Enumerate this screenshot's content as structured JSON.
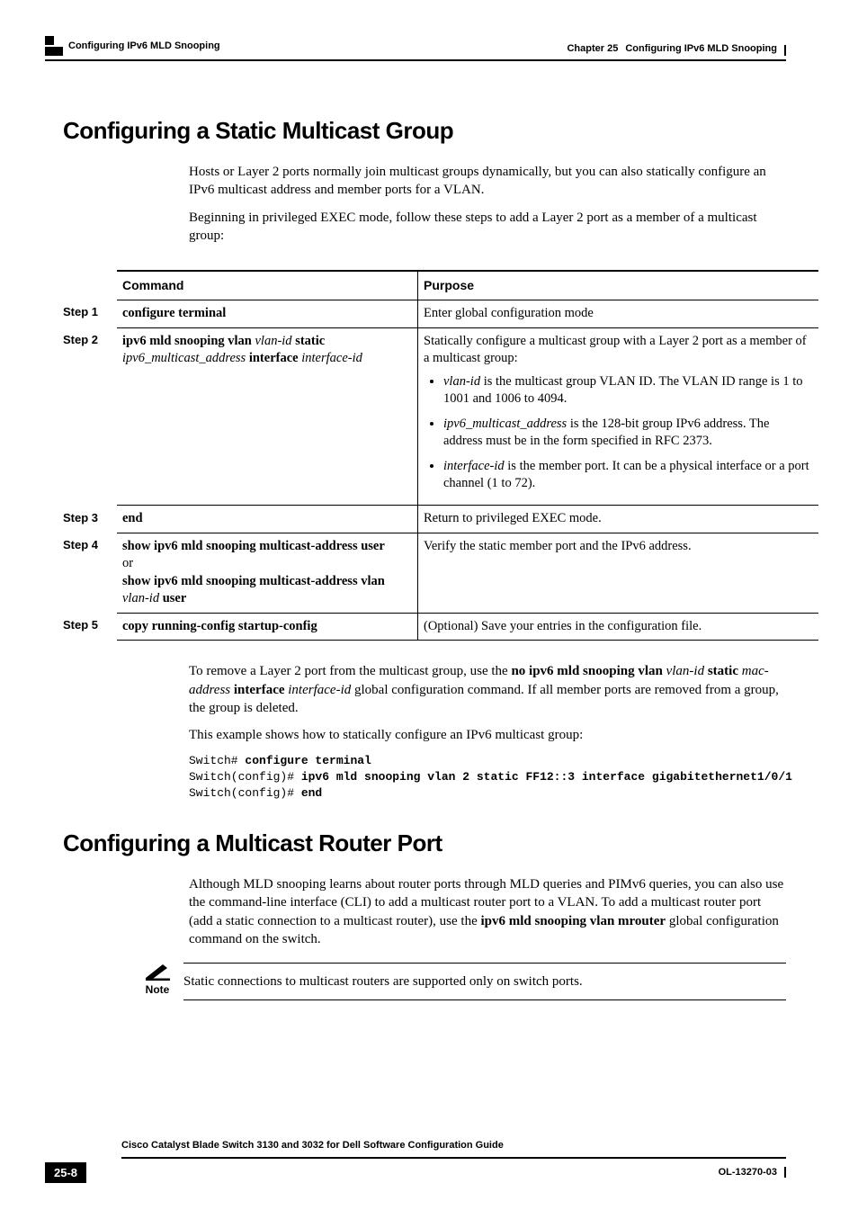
{
  "header": {
    "left_crumb": "Configuring IPv6 MLD Snooping",
    "chapter_label": "Chapter 25",
    "chapter_title": "Configuring IPv6 MLD Snooping"
  },
  "section1": {
    "title": "Configuring a Static Multicast Group",
    "p1": "Hosts or Layer 2 ports normally join multicast groups dynamically, but you can also statically configure an IPv6 multicast address and member ports for a VLAN.",
    "p2": "Beginning in privileged EXEC mode, follow these steps to add a Layer 2 port as a member of a multicast group:"
  },
  "table": {
    "head_step": "",
    "head_cmd": "Command",
    "head_purpose": "Purpose",
    "rows": [
      {
        "step": "Step 1",
        "cmd_parts": [
          {
            "t": "configure terminal",
            "b": true
          }
        ],
        "purpose_html": "Enter global configuration mode"
      },
      {
        "step": "Step 2",
        "cmd_parts": [
          {
            "t": "ipv6 mld snooping vlan ",
            "b": true
          },
          {
            "t": "vlan-id",
            "i": true
          },
          {
            "t": " static",
            "b": true
          },
          {
            "br": true
          },
          {
            "t": "ipv6_multicast_address",
            "i": true
          },
          {
            "t": " interface ",
            "b": true
          },
          {
            "t": "interface-id",
            "i": true
          }
        ],
        "purpose_intro": "Statically configure a multicast group with a Layer 2 port as a member of a multicast group:",
        "bullets": [
          [
            {
              "t": "vlan-id",
              "i": true
            },
            " is the multicast group VLAN ID. The VLAN ID range is 1 to 1001 and 1006 to 4094."
          ],
          [
            {
              "t": "ipv6_multicast_address",
              "i": true
            },
            " is the 128-bit group IPv6 address. The address must be in the form specified in RFC 2373."
          ],
          [
            {
              "t": "interface-id",
              "i": true
            },
            " is the member port. It can be a physical interface or a port channel (1 to 72)."
          ]
        ]
      },
      {
        "step": "Step 3",
        "cmd_parts": [
          {
            "t": "end",
            "b": true
          }
        ],
        "purpose_html": "Return to privileged EXEC mode."
      },
      {
        "step": "Step 4",
        "cmd_parts": [
          {
            "t": "show ipv6 mld snooping multicast-address user",
            "b": true
          },
          {
            "br": true
          },
          {
            "t": "or"
          },
          {
            "br": true
          },
          {
            "t": "show ipv6 mld snooping multicast-address vlan ",
            "b": true
          },
          {
            "t": "vlan-id",
            "i": true
          },
          {
            "t": " user",
            "b": true
          }
        ],
        "purpose_html": "Verify the static member port and the IPv6 address."
      },
      {
        "step": "Step 5",
        "cmd_parts": [
          {
            "t": "copy running-config startup-config",
            "b": true
          }
        ],
        "purpose_html": "(Optional) Save your entries in the configuration file."
      }
    ]
  },
  "after_table": {
    "p1_pre": "To remove a Layer 2 port from the multicast group, use the ",
    "p1_cmd1": "no ipv6 mld snooping vlan ",
    "p1_vlan": "vlan-id",
    "p1_static": " static ",
    "p1_mac": "mac-address",
    "p1_iface": " interface ",
    "p1_ifaceid": "interface-id",
    "p1_post": " global configuration command. If all member ports are removed from a group, the group is deleted.",
    "p2": "This example shows how to statically configure an IPv6 multicast group:",
    "code_lines": [
      [
        {
          "t": "Switch# "
        },
        {
          "t": "configure terminal",
          "b": true
        }
      ],
      [
        {
          "t": "Switch(config)# "
        },
        {
          "t": "ipv6 mld snooping vlan 2 static FF12::3 interface gigabitethernet1/0/1",
          "b": true
        }
      ],
      [
        {
          "t": "Switch(config)# "
        },
        {
          "t": "end",
          "b": true
        }
      ]
    ]
  },
  "section2": {
    "title": "Configuring a Multicast Router Port",
    "p1_pre": "Although MLD snooping learns about router ports through MLD queries and PIMv6 queries, you can also use the command-line interface (CLI) to add a multicast router port to a VLAN. To add a multicast router port (add a static connection to a multicast router), use the ",
    "p1_cmd": "ipv6 mld snooping vlan mrouter",
    "p1_post": " global configuration command on the switch."
  },
  "note": {
    "label": "Note",
    "text": "Static connections to multicast routers are supported only on switch ports."
  },
  "footer": {
    "guide_title": "Cisco Catalyst Blade Switch 3130 and 3032 for Dell Software Configuration Guide",
    "page": "25-8",
    "docid": "OL-13270-03"
  }
}
